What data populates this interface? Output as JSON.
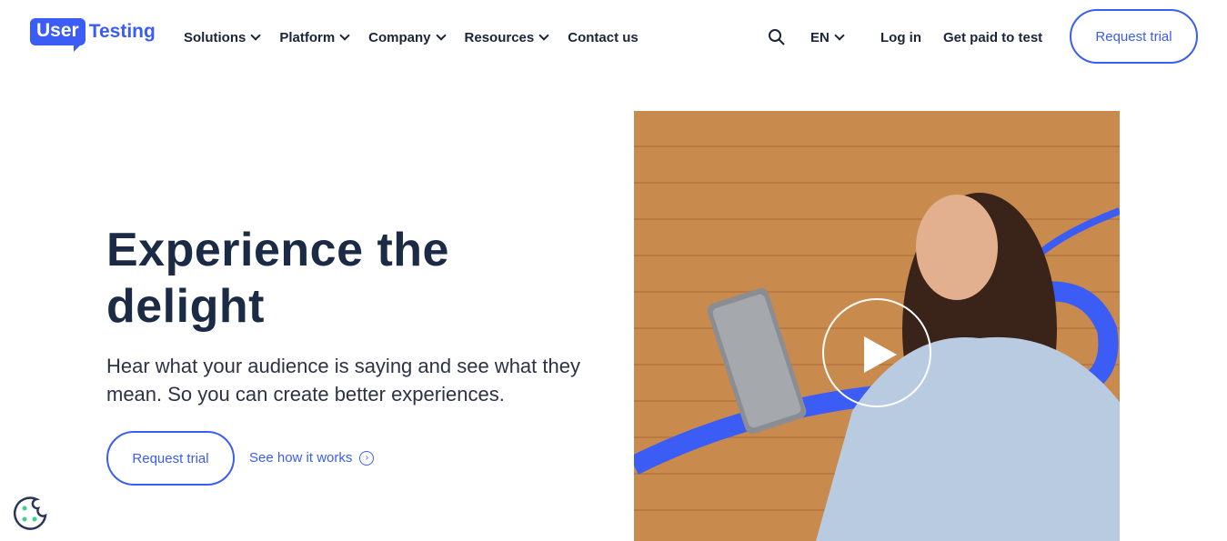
{
  "brand": {
    "logo_part1": "User",
    "logo_part2": "Testing",
    "accent": "#3b5cf5"
  },
  "nav": {
    "items": [
      "Solutions",
      "Platform",
      "Company",
      "Resources",
      "Contact us"
    ],
    "language": "EN",
    "login": "Log in",
    "get_paid": "Get paid to test",
    "request_trial": "Request trial"
  },
  "hero": {
    "title": "Experience the delight",
    "subtitle": "Hear what your audience is saying and see what they mean. So you can create better experiences.",
    "primary_cta": "Request trial",
    "secondary_cta": "See how it works"
  }
}
